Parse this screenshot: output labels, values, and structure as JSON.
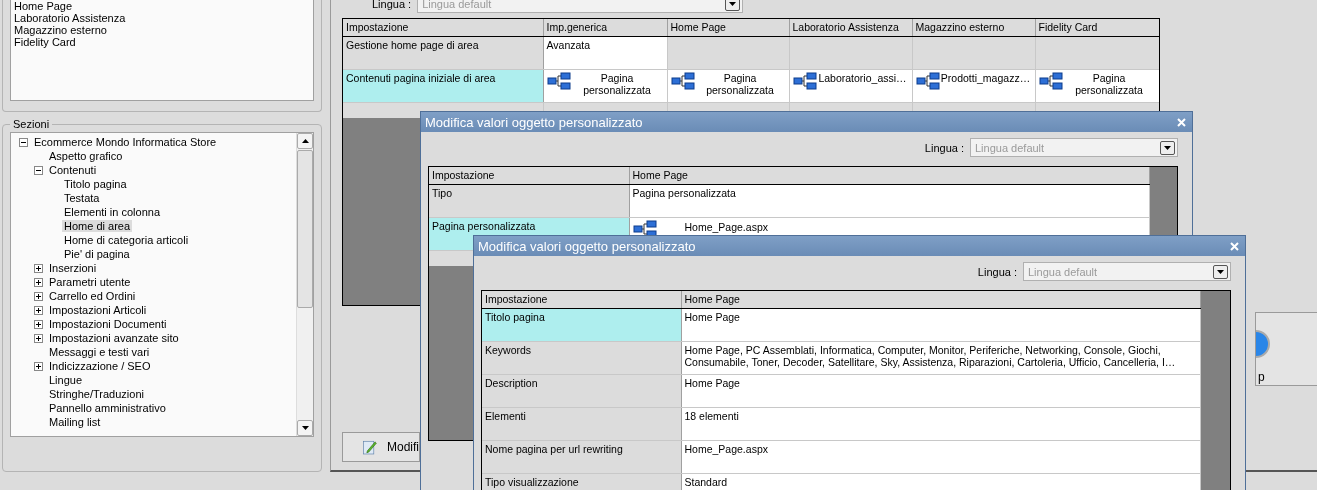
{
  "top_list": {
    "items": [
      "Home Page",
      "Laboratorio Assistenza",
      "Magazzino esterno",
      "Fidelity Card"
    ]
  },
  "sections": {
    "title": "Sezioni",
    "tree": [
      {
        "label": "Ecommerce Mondo Informatica Store",
        "selected": false,
        "expanded": true,
        "children": [
          {
            "label": "Aspetto grafico",
            "selected": false
          },
          {
            "label": "Contenuti",
            "selected": false,
            "expanded": true,
            "children": [
              {
                "label": "Titolo pagina",
                "selected": false
              },
              {
                "label": "Testata",
                "selected": false
              },
              {
                "label": "Elementi in colonna",
                "selected": false
              },
              {
                "label": "Home di area",
                "selected": true
              },
              {
                "label": "Home di categoria articoli",
                "selected": false
              },
              {
                "label": "Pie' di pagina",
                "selected": false
              }
            ]
          },
          {
            "label": "Inserzioni",
            "selected": false,
            "expanded": false
          },
          {
            "label": "Parametri utente",
            "selected": false,
            "expanded": false
          },
          {
            "label": "Carrello ed Ordini",
            "selected": false,
            "expanded": false
          },
          {
            "label": "Impostazioni Articoli",
            "selected": false,
            "expanded": false
          },
          {
            "label": "Impostazioni Documenti",
            "selected": false,
            "expanded": false
          },
          {
            "label": "Impostazioni avanzate sito",
            "selected": false,
            "expanded": false
          },
          {
            "label": "Messaggi e testi vari",
            "selected": false
          },
          {
            "label": "Indicizzazione / SEO",
            "selected": false,
            "expanded": false
          },
          {
            "label": "Lingue",
            "selected": false
          },
          {
            "label": "Stringhe/Traduzioni",
            "selected": false
          },
          {
            "label": "Pannello amministrativo",
            "selected": false
          },
          {
            "label": "Mailing list",
            "selected": false
          }
        ]
      }
    ]
  },
  "language": {
    "label": "Lingua :",
    "value": "Lingua default"
  },
  "table": {
    "columns": [
      "Impostazione",
      "Imp.generica",
      "Home Page",
      "Laboratorio Assistenza",
      "Magazzino esterno",
      "Fidelity Card"
    ],
    "rows": [
      {
        "selected": false,
        "cells": [
          {
            "kind": "label",
            "text": "Gestione home page di area"
          },
          {
            "kind": "text",
            "text": "Avanzata"
          },
          {
            "kind": "empty"
          },
          {
            "kind": "empty"
          },
          {
            "kind": "empty"
          },
          {
            "kind": "empty"
          }
        ]
      },
      {
        "selected": true,
        "cells": [
          {
            "kind": "label",
            "text": "Contenuti pagina iniziale di area"
          },
          {
            "kind": "link",
            "text": "Pagina personalizzata"
          },
          {
            "kind": "link",
            "text": "Pagina personalizzata"
          },
          {
            "kind": "link",
            "text": "Laboratorio_assi…"
          },
          {
            "kind": "link",
            "text": "Prodotti_magazz…"
          },
          {
            "kind": "link",
            "text": "Pagina personalizzata"
          }
        ]
      }
    ]
  },
  "buttons": [
    {
      "kind": "edit",
      "label": "Modifi"
    },
    {
      "kind": "help",
      "label": "p"
    }
  ],
  "dialogs": [
    {
      "title": "Modifica valori oggetto personalizzato",
      "language": {
        "label": "Lingua :",
        "value": "Lingua default"
      },
      "columns": [
        "Impostazione",
        "Home Page"
      ],
      "rows": [
        {
          "selected": false,
          "cells": [
            {
              "kind": "label",
              "text": "Tipo"
            },
            {
              "kind": "text",
              "text": "Pagina personalizzata"
            }
          ]
        },
        {
          "selected": true,
          "cells": [
            {
              "kind": "label",
              "text": "Pagina personalizzata"
            },
            {
              "kind": "link",
              "text": "Home_Page.aspx"
            }
          ]
        }
      ]
    },
    {
      "title": "Modifica valori oggetto personalizzato",
      "language": {
        "label": "Lingua :",
        "value": "Lingua default"
      },
      "columns": [
        "Impostazione",
        "Home Page"
      ],
      "rows": [
        {
          "selected": true,
          "cells": [
            {
              "kind": "label",
              "text": "Titolo pagina"
            },
            {
              "kind": "text",
              "text": "Home Page"
            }
          ]
        },
        {
          "selected": false,
          "cells": [
            {
              "kind": "label",
              "text": "Keywords"
            },
            {
              "kind": "text",
              "text": "Home Page, PC Assemblati, Informatica, Computer, Monitor, Periferiche, Networking, Console, Giochi, Consumabile, Toner, Decoder, Satellitare, Sky, Assistenza, Riparazioni, Cartoleria, Ufficio, Cancelleria, I…"
            }
          ]
        },
        {
          "selected": false,
          "cells": [
            {
              "kind": "label",
              "text": "Description"
            },
            {
              "kind": "text",
              "text": "Home Page"
            }
          ]
        },
        {
          "selected": false,
          "cells": [
            {
              "kind": "label",
              "text": "Elementi"
            },
            {
              "kind": "text",
              "text": "18 elementi"
            }
          ]
        },
        {
          "selected": false,
          "cells": [
            {
              "kind": "label",
              "text": "Nome pagina per url rewriting"
            },
            {
              "kind": "text",
              "text": "Home_Page.aspx"
            }
          ]
        },
        {
          "selected": false,
          "cells": [
            {
              "kind": "label",
              "text": "Tipo visualizzazione"
            },
            {
              "kind": "text",
              "text": "Standard"
            }
          ]
        }
      ]
    }
  ]
}
